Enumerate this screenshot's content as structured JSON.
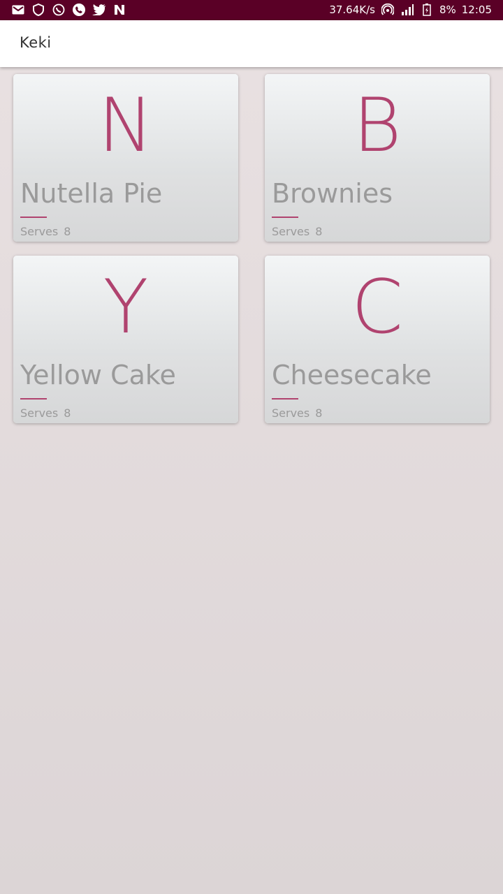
{
  "status_bar": {
    "network_speed": "37.64K/s",
    "battery": "8%",
    "time": "12:05",
    "left_icons": [
      "gmail-icon",
      "shield-icon",
      "whatsapp-icon",
      "phone-icon",
      "twitter-icon",
      "n-app-icon"
    ],
    "right_icons": [
      "hotspot-icon",
      "signal-icon",
      "battery-icon"
    ]
  },
  "app_bar": {
    "title": "Keki"
  },
  "colors": {
    "status_bar": "#5a0026",
    "accent": "#b0436f",
    "muted_text": "#9a9a9a"
  },
  "recipes": [
    {
      "letter": "N",
      "name": "Nutella Pie",
      "serves_label": "Serves",
      "serves": "8"
    },
    {
      "letter": "B",
      "name": "Brownies",
      "serves_label": "Serves",
      "serves": "8"
    },
    {
      "letter": "Y",
      "name": "Yellow Cake",
      "serves_label": "Serves",
      "serves": "8"
    },
    {
      "letter": "C",
      "name": "Cheesecake",
      "serves_label": "Serves",
      "serves": "8"
    }
  ]
}
